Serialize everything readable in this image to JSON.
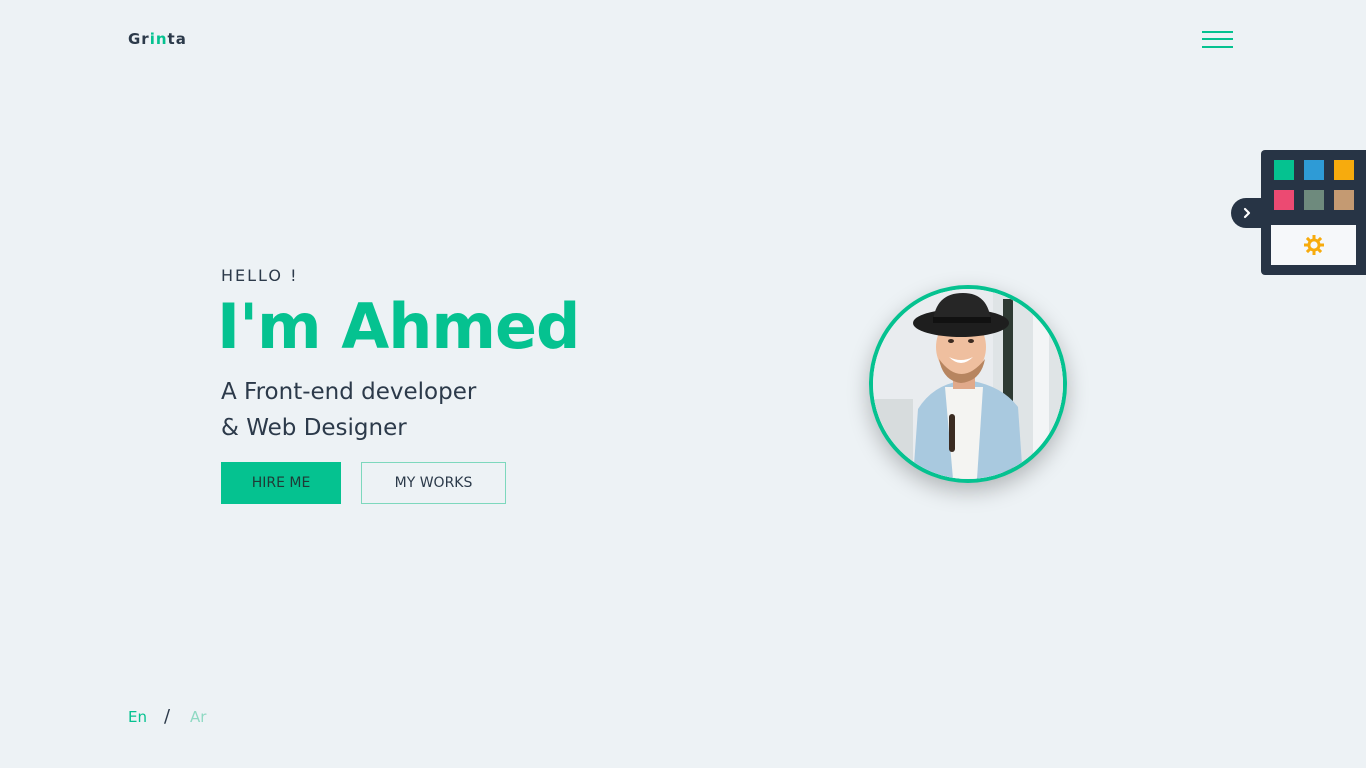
{
  "header": {
    "logo_part1": "Gr",
    "logo_part2": "in",
    "logo_part3": "ta",
    "menu_icon": "hamburger-icon"
  },
  "hero": {
    "greeting": "HELLO !",
    "name": "I'm Ahmed",
    "role_line1": "A Front-end developer",
    "role_line2": "& Web Designer",
    "hire_label": "HIRE ME",
    "works_label": "MY WORKS"
  },
  "avatar": {
    "alt": "Profile photo of a smiling man in a black hat"
  },
  "switcher": {
    "colors": [
      "#05c290",
      "#2e9bd6",
      "#f7ab0d",
      "#ec4a72",
      "#6e8a7d",
      "#c49a72"
    ],
    "toggle_icon": "chevron-right-icon",
    "settings_icon": "gear-icon"
  },
  "language": {
    "en": "En",
    "separator": "/",
    "ar": "Ar"
  },
  "theme": {
    "accent": "#05c290",
    "background": "#edf2f5",
    "text": "#2c3a4a",
    "panel": "#273445"
  }
}
